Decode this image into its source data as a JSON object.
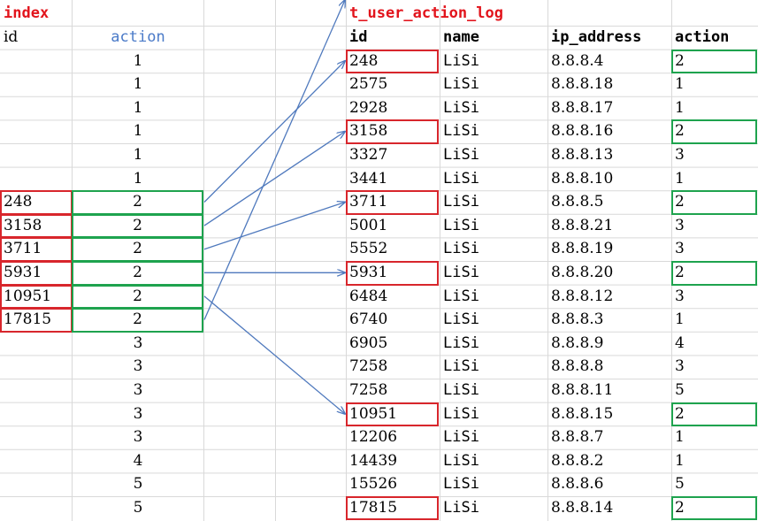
{
  "left_table": {
    "title": "index",
    "headers": [
      "id",
      "action"
    ],
    "rows": [
      [
        "",
        "1"
      ],
      [
        "",
        "1"
      ],
      [
        "",
        "1"
      ],
      [
        "",
        "1"
      ],
      [
        "",
        "1"
      ],
      [
        "",
        "1"
      ],
      [
        "248",
        "2"
      ],
      [
        "3158",
        "2"
      ],
      [
        "3711",
        "2"
      ],
      [
        "5931",
        "2"
      ],
      [
        "10951",
        "2"
      ],
      [
        "17815",
        "2"
      ],
      [
        "",
        "3"
      ],
      [
        "",
        "3"
      ],
      [
        "",
        "3"
      ],
      [
        "",
        "3"
      ],
      [
        "",
        "3"
      ],
      [
        "",
        "4"
      ],
      [
        "",
        "5"
      ],
      [
        "",
        "5"
      ]
    ]
  },
  "right_table": {
    "title": "t_user_action_log",
    "headers": [
      "id",
      "name",
      "ip_address",
      "action"
    ],
    "rows": [
      [
        "248",
        "LiSi",
        "8.8.8.4",
        "2"
      ],
      [
        "2575",
        "LiSi",
        "8.8.8.18",
        "1"
      ],
      [
        "2928",
        "LiSi",
        "8.8.8.17",
        "1"
      ],
      [
        "3158",
        "LiSi",
        "8.8.8.16",
        "2"
      ],
      [
        "3327",
        "LiSi",
        "8.8.8.13",
        "3"
      ],
      [
        "3441",
        "LiSi",
        "8.8.8.10",
        "1"
      ],
      [
        "3711",
        "LiSi",
        "8.8.8.5",
        "2"
      ],
      [
        "5001",
        "LiSi",
        "8.8.8.21",
        "3"
      ],
      [
        "5552",
        "LiSi",
        "8.8.8.19",
        "3"
      ],
      [
        "5931",
        "LiSi",
        "8.8.8.20",
        "2"
      ],
      [
        "6484",
        "LiSi",
        "8.8.8.12",
        "3"
      ],
      [
        "6740",
        "LiSi",
        "8.8.8.3",
        "1"
      ],
      [
        "6905",
        "LiSi",
        "8.8.8.9",
        "4"
      ],
      [
        "7258",
        "LiSi",
        "8.8.8.8",
        "3"
      ],
      [
        "7258",
        "LiSi",
        "8.8.8.11",
        "5"
      ],
      [
        "10951",
        "LiSi",
        "8.8.8.15",
        "2"
      ],
      [
        "12206",
        "LiSi",
        "8.8.8.7",
        "1"
      ],
      [
        "14439",
        "LiSi",
        "8.8.8.2",
        "1"
      ],
      [
        "15526",
        "LiSi",
        "8.8.8.6",
        "5"
      ],
      [
        "17815",
        "LiSi",
        "8.8.8.14",
        "2"
      ]
    ]
  },
  "highlight": {
    "left_rows": [
      6,
      7,
      8,
      9,
      10,
      11
    ],
    "right_rows": [
      0,
      3,
      6,
      9,
      15,
      19
    ],
    "links": [
      [
        6,
        0
      ],
      [
        7,
        3
      ],
      [
        8,
        6
      ],
      [
        9,
        9
      ],
      [
        10,
        15
      ],
      [
        11,
        19
      ]
    ]
  },
  "colors": {
    "title": "#e2141c",
    "header_blue": "#4a7ac8",
    "red_box": "#d8262c",
    "green_box": "#1ea34e",
    "arrow": "#4f79bd",
    "gridline": "#d9d9d9"
  }
}
